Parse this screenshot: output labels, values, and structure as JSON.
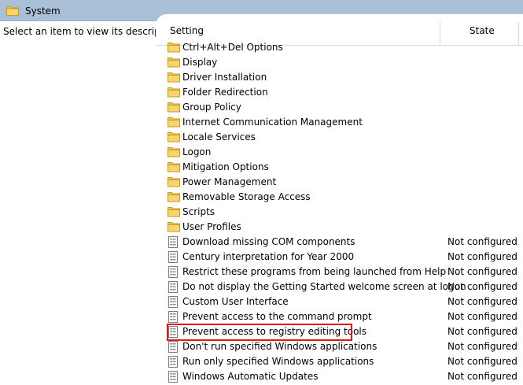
{
  "window": {
    "title": "System"
  },
  "description_hint": "Select an item to view its description.",
  "columns": {
    "setting": "Setting",
    "state": "State"
  },
  "folders": [
    "Ctrl+Alt+Del Options",
    "Display",
    "Driver Installation",
    "Folder Redirection",
    "Group Policy",
    "Internet Communication Management",
    "Locale Services",
    "Logon",
    "Mitigation Options",
    "Power Management",
    "Removable Storage Access",
    "Scripts",
    "User Profiles"
  ],
  "policies": [
    {
      "name": "Download missing COM components",
      "state": "Not configured"
    },
    {
      "name": "Century interpretation for Year 2000",
      "state": "Not configured"
    },
    {
      "name": "Restrict these programs from being launched from Help",
      "state": "Not configured"
    },
    {
      "name": "Do not display the Getting Started welcome screen at logon",
      "state": "Not configured"
    },
    {
      "name": "Custom User Interface",
      "state": "Not configured"
    },
    {
      "name": "Prevent access to the command prompt",
      "state": "Not configured"
    },
    {
      "name": "Prevent access to registry editing tools",
      "state": "Not configured",
      "highlighted": true
    },
    {
      "name": "Don't run specified Windows applications",
      "state": "Not configured"
    },
    {
      "name": "Run only specified Windows applications",
      "state": "Not configured"
    },
    {
      "name": "Windows Automatic Updates",
      "state": "Not configured"
    }
  ],
  "colors": {
    "titlebar": "#a9c0d8",
    "folder": "#f3c64b",
    "highlight_border": "#e0161b"
  },
  "icons": {
    "folder": "folder-icon",
    "policy": "policy-setting-icon"
  }
}
